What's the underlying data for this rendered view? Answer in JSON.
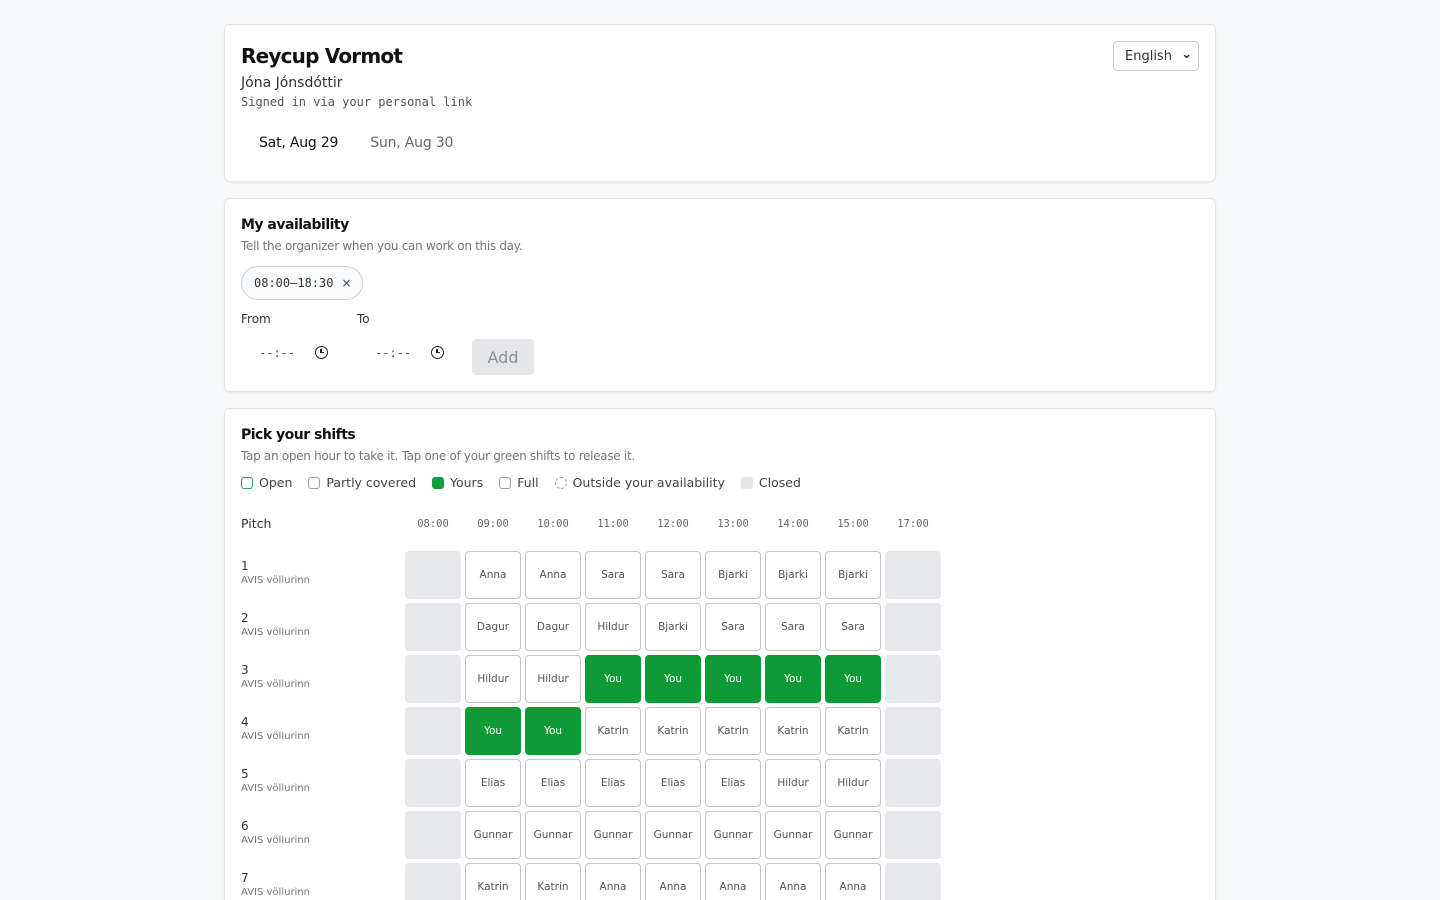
{
  "header": {
    "event_title": "Reycup Vormot",
    "user_name": "Jóna Jónsdóttir",
    "signed_in_text": "Signed in via your personal link",
    "language": "English",
    "days": [
      {
        "label": "Sat, Aug 29",
        "active": true
      },
      {
        "label": "Sun, Aug 30",
        "active": false
      }
    ]
  },
  "availability": {
    "title": "My availability",
    "subtitle": "Tell the organizer when you can work on this day.",
    "range_chip": "08:00–18:30",
    "remove_symbol": "×",
    "from_label": "From",
    "to_label": "To",
    "from_value": "--:--",
    "to_value": "--:--",
    "add_label": "Add"
  },
  "shifts": {
    "title": "Pick your shifts",
    "subtitle": "Tap an open hour to take it. Tap one of your green shifts to release it.",
    "legend": [
      {
        "key": "open",
        "label": "Open"
      },
      {
        "key": "partly",
        "label": "Partly covered"
      },
      {
        "key": "yours",
        "label": "Yours"
      },
      {
        "key": "full",
        "label": "Full"
      },
      {
        "key": "outside",
        "label": "Outside your availability"
      },
      {
        "key": "closed",
        "label": "Closed"
      }
    ],
    "pitch_header": "Pitch",
    "hours": [
      "08:00",
      "09:00",
      "10:00",
      "11:00",
      "12:00",
      "13:00",
      "14:00",
      "15:00",
      "17:00"
    ],
    "rows": [
      {
        "name": "1",
        "location": "AVIS völlurinn",
        "cells": [
          "",
          "Anna",
          "Anna",
          "Sara",
          "Sara",
          "Bjarki",
          "Bjarki",
          "Bjarki",
          ""
        ]
      },
      {
        "name": "2",
        "location": "AVIS völlurinn",
        "cells": [
          "",
          "Dagur",
          "Dagur",
          "Hildur",
          "Bjarki",
          "Sara",
          "Sara",
          "Sara",
          ""
        ]
      },
      {
        "name": "3",
        "location": "AVIS völlurinn",
        "cells": [
          "",
          "Hildur",
          "Hildur",
          "You",
          "You",
          "You",
          "You",
          "You",
          ""
        ]
      },
      {
        "name": "4",
        "location": "AVIS völlurinn",
        "cells": [
          "",
          "You",
          "You",
          "Katrin",
          "Katrin",
          "Katrin",
          "Katrin",
          "Katrin",
          ""
        ]
      },
      {
        "name": "5",
        "location": "AVIS völlurinn",
        "cells": [
          "",
          "Elias",
          "Elias",
          "Elias",
          "Elias",
          "Elias",
          "Hildur",
          "Hildur",
          ""
        ]
      },
      {
        "name": "6",
        "location": "AVIS völlurinn",
        "cells": [
          "",
          "Gunnar",
          "Gunnar",
          "Gunnar",
          "Gunnar",
          "Gunnar",
          "Gunnar",
          "Gunnar",
          ""
        ]
      },
      {
        "name": "7",
        "location": "AVIS völlurinn",
        "cells": [
          "",
          "Katrin",
          "Katrin",
          "Anna",
          "Anna",
          "Anna",
          "Anna",
          "Anna",
          ""
        ]
      }
    ]
  },
  "colors": {
    "yours": "#0f9a36",
    "closed": "#e6e8eb",
    "open_border": "#19a54b"
  }
}
